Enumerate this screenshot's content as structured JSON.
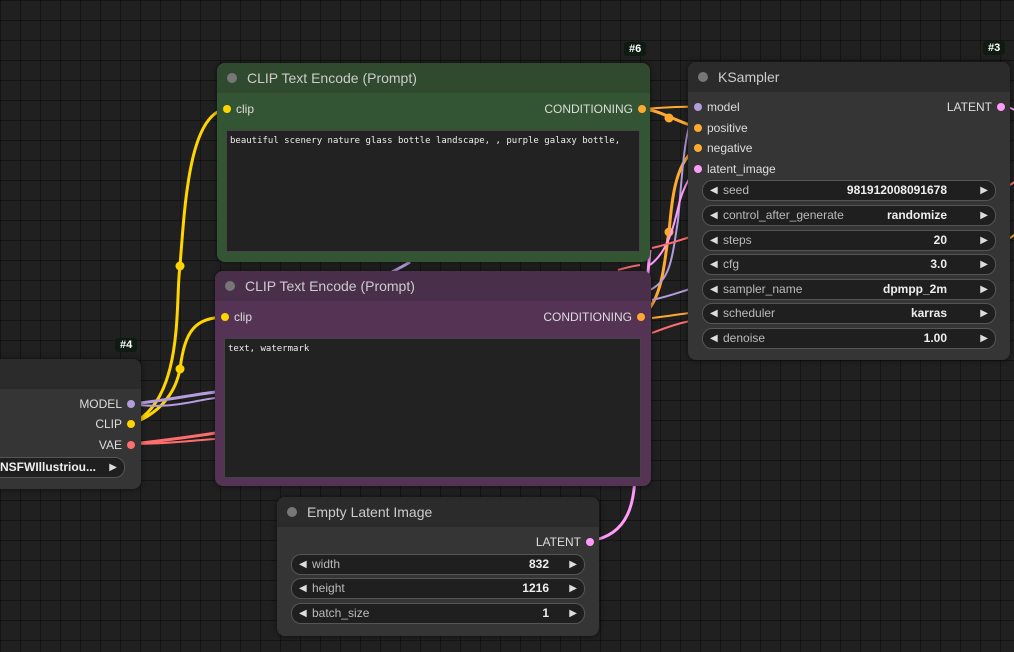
{
  "colors": {
    "clip_yellow": "#ffd500",
    "conditioning_orange": "#ffa931",
    "model_lavender": "#b39ddb",
    "vae_red": "#ff6e6e",
    "latent_pink": "#ff9cf9",
    "positive_node_body": "#335533",
    "negative_node_body": "#553355"
  },
  "nodes": {
    "clip_pos": {
      "badge": "#6",
      "title": "CLIP Text Encode (Prompt)",
      "input_clip": "clip",
      "output_conditioning": "CONDITIONING",
      "text": "beautiful scenery nature glass bottle landscape, , purple galaxy bottle,"
    },
    "clip_neg": {
      "title": "CLIP Text Encode (Prompt)",
      "input_clip": "clip",
      "output_conditioning": "CONDITIONING",
      "text": "text, watermark"
    },
    "ksampler": {
      "badge": "#3",
      "title": "KSampler",
      "inputs": [
        "model",
        "positive",
        "negative",
        "latent_image"
      ],
      "output_latent": "LATENT",
      "widgets": [
        {
          "name": "seed",
          "value": "981912008091678"
        },
        {
          "name": "control_after_generate",
          "value": "randomize"
        },
        {
          "name": "steps",
          "value": "20"
        },
        {
          "name": "cfg",
          "value": "3.0"
        },
        {
          "name": "sampler_name",
          "value": "dpmpp_2m"
        },
        {
          "name": "scheduler",
          "value": "karras"
        },
        {
          "name": "denoise",
          "value": "1.00"
        }
      ]
    },
    "checkpoint": {
      "badge": "#4",
      "output_model": "MODEL",
      "output_clip": "CLIP",
      "output_vae": "VAE",
      "ckpt_value": "NSFWIllustriou..."
    },
    "empty_latent": {
      "title": "Empty Latent Image",
      "output_latent": "LATENT",
      "widgets": [
        {
          "name": "width",
          "value": "832"
        },
        {
          "name": "height",
          "value": "1216"
        },
        {
          "name": "batch_size",
          "value": "1"
        }
      ]
    }
  },
  "icons": {
    "left_arrow": "◀",
    "right_arrow": "▶"
  }
}
